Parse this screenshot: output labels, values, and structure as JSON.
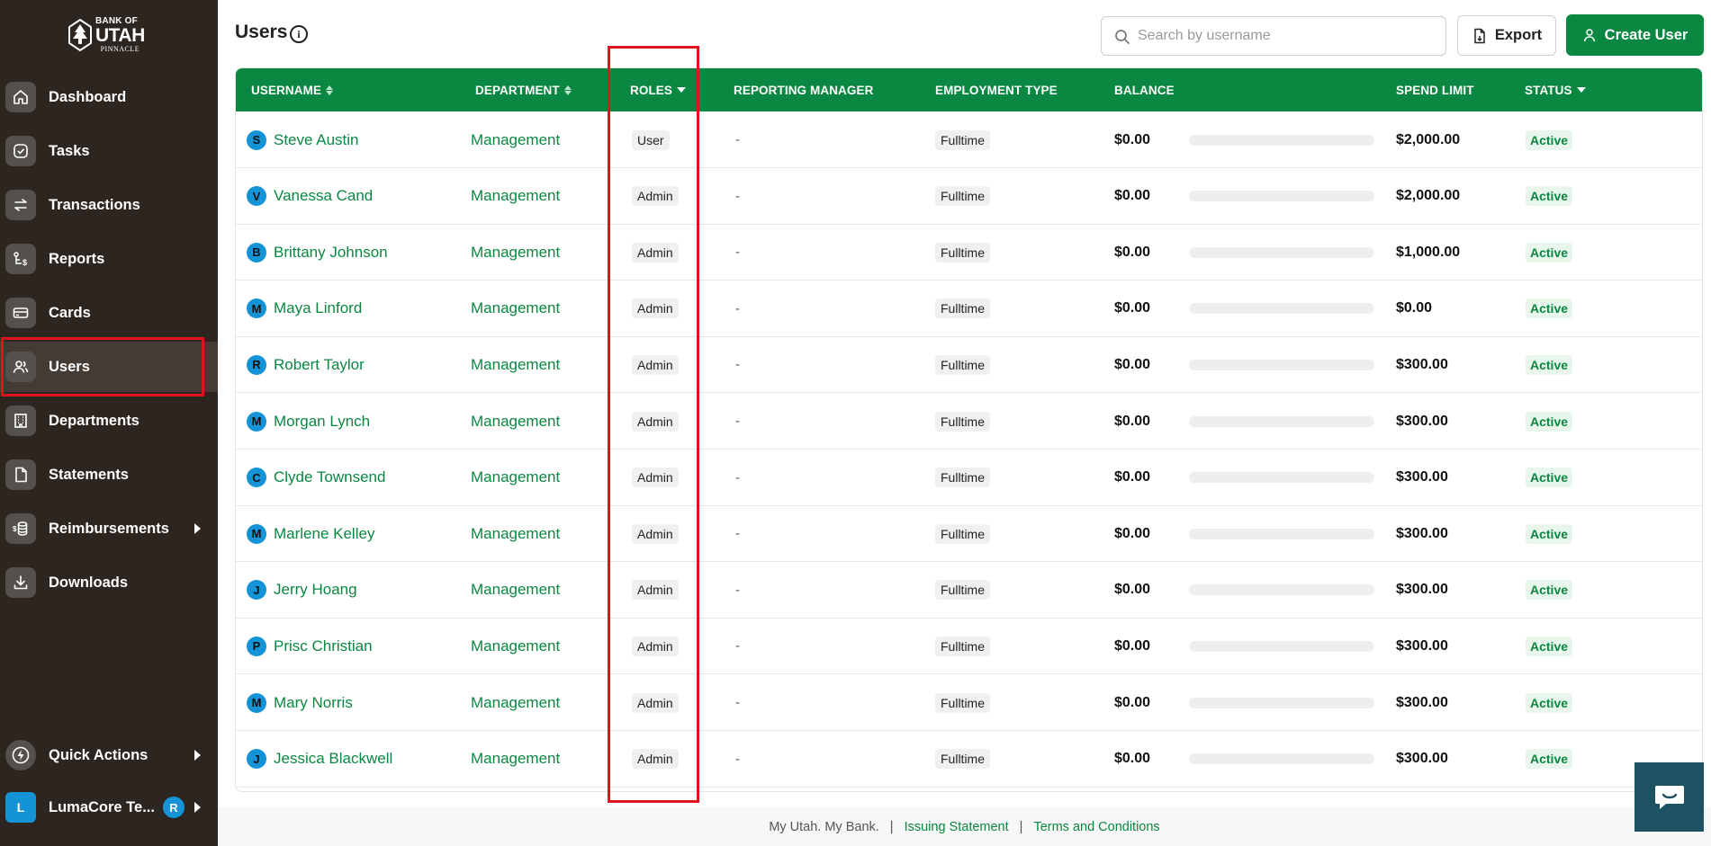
{
  "brand": {
    "line1": "BANK OF",
    "line2": "UTAH",
    "line3": "PINNACLE"
  },
  "sidebar": {
    "items": [
      {
        "label": "Dashboard",
        "icon": "home-icon"
      },
      {
        "label": "Tasks",
        "icon": "check-circle-icon"
      },
      {
        "label": "Transactions",
        "icon": "transfer-arrows-icon"
      },
      {
        "label": "Reports",
        "icon": "reports-icon"
      },
      {
        "label": "Cards",
        "icon": "card-icon"
      },
      {
        "label": "Users",
        "icon": "users-icon",
        "active": true
      },
      {
        "label": "Departments",
        "icon": "building-icon"
      },
      {
        "label": "Statements",
        "icon": "document-icon"
      },
      {
        "label": "Reimbursements",
        "icon": "coins-icon",
        "has_submenu": true
      },
      {
        "label": "Downloads",
        "icon": "download-icon"
      }
    ],
    "quick_actions": {
      "label": "Quick Actions",
      "icon": "lightning-icon"
    },
    "org": {
      "initial": "L",
      "label": "LumaCore Te...",
      "user_initial": "R"
    }
  },
  "header": {
    "title": "Users",
    "search_placeholder": "Search by username",
    "export_label": "Export",
    "create_label": "Create User"
  },
  "table": {
    "columns": {
      "username": "USERNAME",
      "department": "DEPARTMENT",
      "roles": "ROLES",
      "manager": "REPORTING MANAGER",
      "employment": "EMPLOYMENT TYPE",
      "balance": "BALANCE",
      "spend_limit": "SPEND LIMIT",
      "status": "STATUS"
    },
    "rows": [
      {
        "initial": "S",
        "username": "Steve Austin",
        "department": "Management",
        "role": "User",
        "manager": "-",
        "employment": "Fulltime",
        "balance": "$0.00",
        "spent_fraction": 0,
        "spend_limit": "$2,000.00",
        "status": "Active"
      },
      {
        "initial": "V",
        "username": "Vanessa Cand",
        "department": "Management",
        "role": "Admin",
        "manager": "-",
        "employment": "Fulltime",
        "balance": "$0.00",
        "spent_fraction": 0,
        "spend_limit": "$2,000.00",
        "status": "Active"
      },
      {
        "initial": "B",
        "username": "Brittany Johnson",
        "department": "Management",
        "role": "Admin",
        "manager": "-",
        "employment": "Fulltime",
        "balance": "$0.00",
        "spent_fraction": 0,
        "spend_limit": "$1,000.00",
        "status": "Active"
      },
      {
        "initial": "M",
        "username": "Maya Linford",
        "department": "Management",
        "role": "Admin",
        "manager": "-",
        "employment": "Fulltime",
        "balance": "$0.00",
        "spent_fraction": 0,
        "spend_limit": "$0.00",
        "status": "Active"
      },
      {
        "initial": "R",
        "username": "Robert Taylor",
        "department": "Management",
        "role": "Admin",
        "manager": "-",
        "employment": "Fulltime",
        "balance": "$0.00",
        "spent_fraction": 0,
        "spend_limit": "$300.00",
        "status": "Active"
      },
      {
        "initial": "M",
        "username": "Morgan Lynch",
        "department": "Management",
        "role": "Admin",
        "manager": "-",
        "employment": "Fulltime",
        "balance": "$0.00",
        "spent_fraction": 0,
        "spend_limit": "$300.00",
        "status": "Active"
      },
      {
        "initial": "C",
        "username": "Clyde Townsend",
        "department": "Management",
        "role": "Admin",
        "manager": "-",
        "employment": "Fulltime",
        "balance": "$0.00",
        "spent_fraction": 0,
        "spend_limit": "$300.00",
        "status": "Active"
      },
      {
        "initial": "M",
        "username": "Marlene Kelley",
        "department": "Management",
        "role": "Admin",
        "manager": "-",
        "employment": "Fulltime",
        "balance": "$0.00",
        "spent_fraction": 0,
        "spend_limit": "$300.00",
        "status": "Active"
      },
      {
        "initial": "J",
        "username": "Jerry Hoang",
        "department": "Management",
        "role": "Admin",
        "manager": "-",
        "employment": "Fulltime",
        "balance": "$0.00",
        "spent_fraction": 0,
        "spend_limit": "$300.00",
        "status": "Active"
      },
      {
        "initial": "P",
        "username": "Prisc Christian",
        "department": "Management",
        "role": "Admin",
        "manager": "-",
        "employment": "Fulltime",
        "balance": "$0.00",
        "spent_fraction": 0,
        "spend_limit": "$300.00",
        "status": "Active"
      },
      {
        "initial": "M",
        "username": "Mary Norris",
        "department": "Management",
        "role": "Admin",
        "manager": "-",
        "employment": "Fulltime",
        "balance": "$0.00",
        "spent_fraction": 0,
        "spend_limit": "$300.00",
        "status": "Active"
      },
      {
        "initial": "J",
        "username": "Jessica Blackwell",
        "department": "Management",
        "role": "Admin",
        "manager": "-",
        "employment": "Fulltime",
        "balance": "$0.00",
        "spent_fraction": 0,
        "spend_limit": "$300.00",
        "status": "Active"
      }
    ]
  },
  "footer": {
    "tagline": "My Utah. My Bank.",
    "sep1": "|",
    "link1": "Issuing Statement",
    "sep2": "|",
    "link2": "Terms and Conditions"
  },
  "colors": {
    "brand_green": "#0a8741",
    "sidebar_bg": "#2d2520",
    "avatar_blue": "#1493d6",
    "highlight_red": "#e0141e",
    "chat_teal": "#1d5262"
  }
}
